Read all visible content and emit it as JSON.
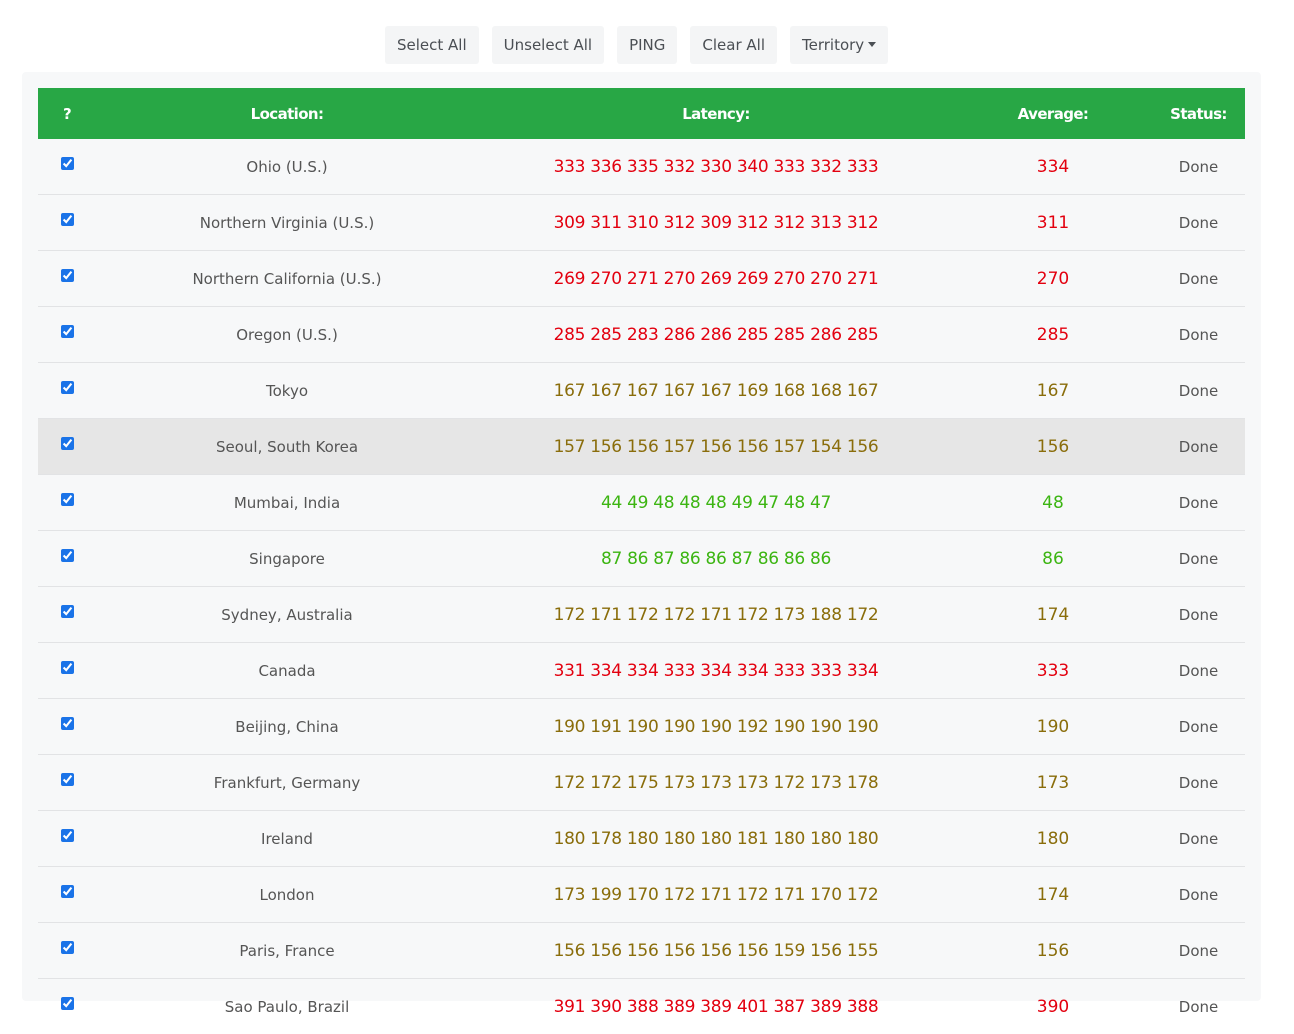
{
  "toolbar": {
    "select_all": "Select All",
    "unselect_all": "Unselect All",
    "ping": "PING",
    "clear_all": "Clear All",
    "territory": "Territory"
  },
  "table": {
    "headers": {
      "check": "?",
      "location": "Location:",
      "latency": "Latency:",
      "average": "Average:",
      "status": "Status:"
    },
    "colors": {
      "red": "#e3000f",
      "olive": "#8a6d0b",
      "green": "#3cb512"
    },
    "rows": [
      {
        "checked": true,
        "location": "Ohio (U.S.)",
        "latency": "333 336 335 332 330 340 333 332 333",
        "average": "334",
        "status": "Done",
        "color": "red"
      },
      {
        "checked": true,
        "location": "Northern Virginia (U.S.)",
        "latency": "309 311 310 312 309 312 312 313 312",
        "average": "311",
        "status": "Done",
        "color": "red"
      },
      {
        "checked": true,
        "location": "Northern California (U.S.)",
        "latency": "269 270 271 270 269 269 270 270 271",
        "average": "270",
        "status": "Done",
        "color": "red"
      },
      {
        "checked": true,
        "location": "Oregon (U.S.)",
        "latency": "285 285 283 286 286 285 285 286 285",
        "average": "285",
        "status": "Done",
        "color": "red"
      },
      {
        "checked": true,
        "location": "Tokyo",
        "latency": "167 167 167 167 167 169 168 168 167",
        "average": "167",
        "status": "Done",
        "color": "olive"
      },
      {
        "checked": true,
        "location": "Seoul, South Korea",
        "latency": "157 156 156 157 156 156 157 154 156",
        "average": "156",
        "status": "Done",
        "color": "olive",
        "highlight": true
      },
      {
        "checked": true,
        "location": "Mumbai, India",
        "latency": "44 49 48 48 48 49 47 48 47",
        "average": "48",
        "status": "Done",
        "color": "green"
      },
      {
        "checked": true,
        "location": "Singapore",
        "latency": "87 86 87 86 86 87 86 86 86",
        "average": "86",
        "status": "Done",
        "color": "green"
      },
      {
        "checked": true,
        "location": "Sydney, Australia",
        "latency": "172 171 172 172 171 172 173 188 172",
        "average": "174",
        "status": "Done",
        "color": "olive"
      },
      {
        "checked": true,
        "location": "Canada",
        "latency": "331 334 334 333 334 334 333 333 334",
        "average": "333",
        "status": "Done",
        "color": "red"
      },
      {
        "checked": true,
        "location": "Beijing, China",
        "latency": "190 191 190 190 190 192 190 190 190",
        "average": "190",
        "status": "Done",
        "color": "olive"
      },
      {
        "checked": true,
        "location": "Frankfurt, Germany",
        "latency": "172 172 175 173 173 173 172 173 178",
        "average": "173",
        "status": "Done",
        "color": "olive"
      },
      {
        "checked": true,
        "location": "Ireland",
        "latency": "180 178 180 180 180 181 180 180 180",
        "average": "180",
        "status": "Done",
        "color": "olive"
      },
      {
        "checked": true,
        "location": "London",
        "latency": "173 199 170 172 171 172 171 170 172",
        "average": "174",
        "status": "Done",
        "color": "olive"
      },
      {
        "checked": true,
        "location": "Paris, France",
        "latency": "156 156 156 156 156 156 159 156 155",
        "average": "156",
        "status": "Done",
        "color": "olive"
      },
      {
        "checked": true,
        "location": "Sao Paulo, Brazil",
        "latency": "391 390 388 389 389 401 387 389 388",
        "average": "390",
        "status": "Done",
        "color": "red"
      }
    ]
  }
}
